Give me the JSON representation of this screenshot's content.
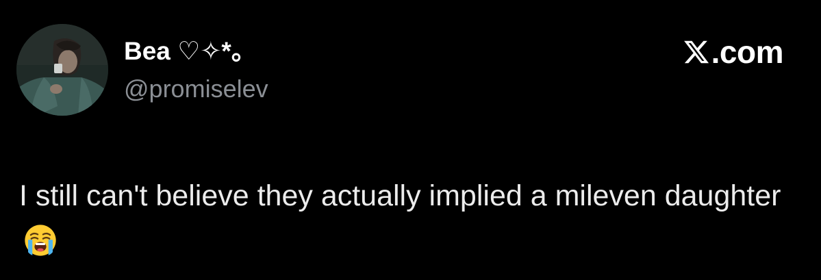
{
  "author": {
    "display_name": "Bea ♡✧*。",
    "handle": "@promiselev"
  },
  "brand": {
    "site_label": ".com",
    "icon": "x-logo-icon"
  },
  "tweet": {
    "text": "I still can't believe they actually implied a mileven daughter",
    "emoji": "loudly-crying-face-emoji"
  },
  "colors": {
    "background": "#000000",
    "name": "#ffffff",
    "handle": "#8b8f95",
    "body": "#ececec"
  }
}
